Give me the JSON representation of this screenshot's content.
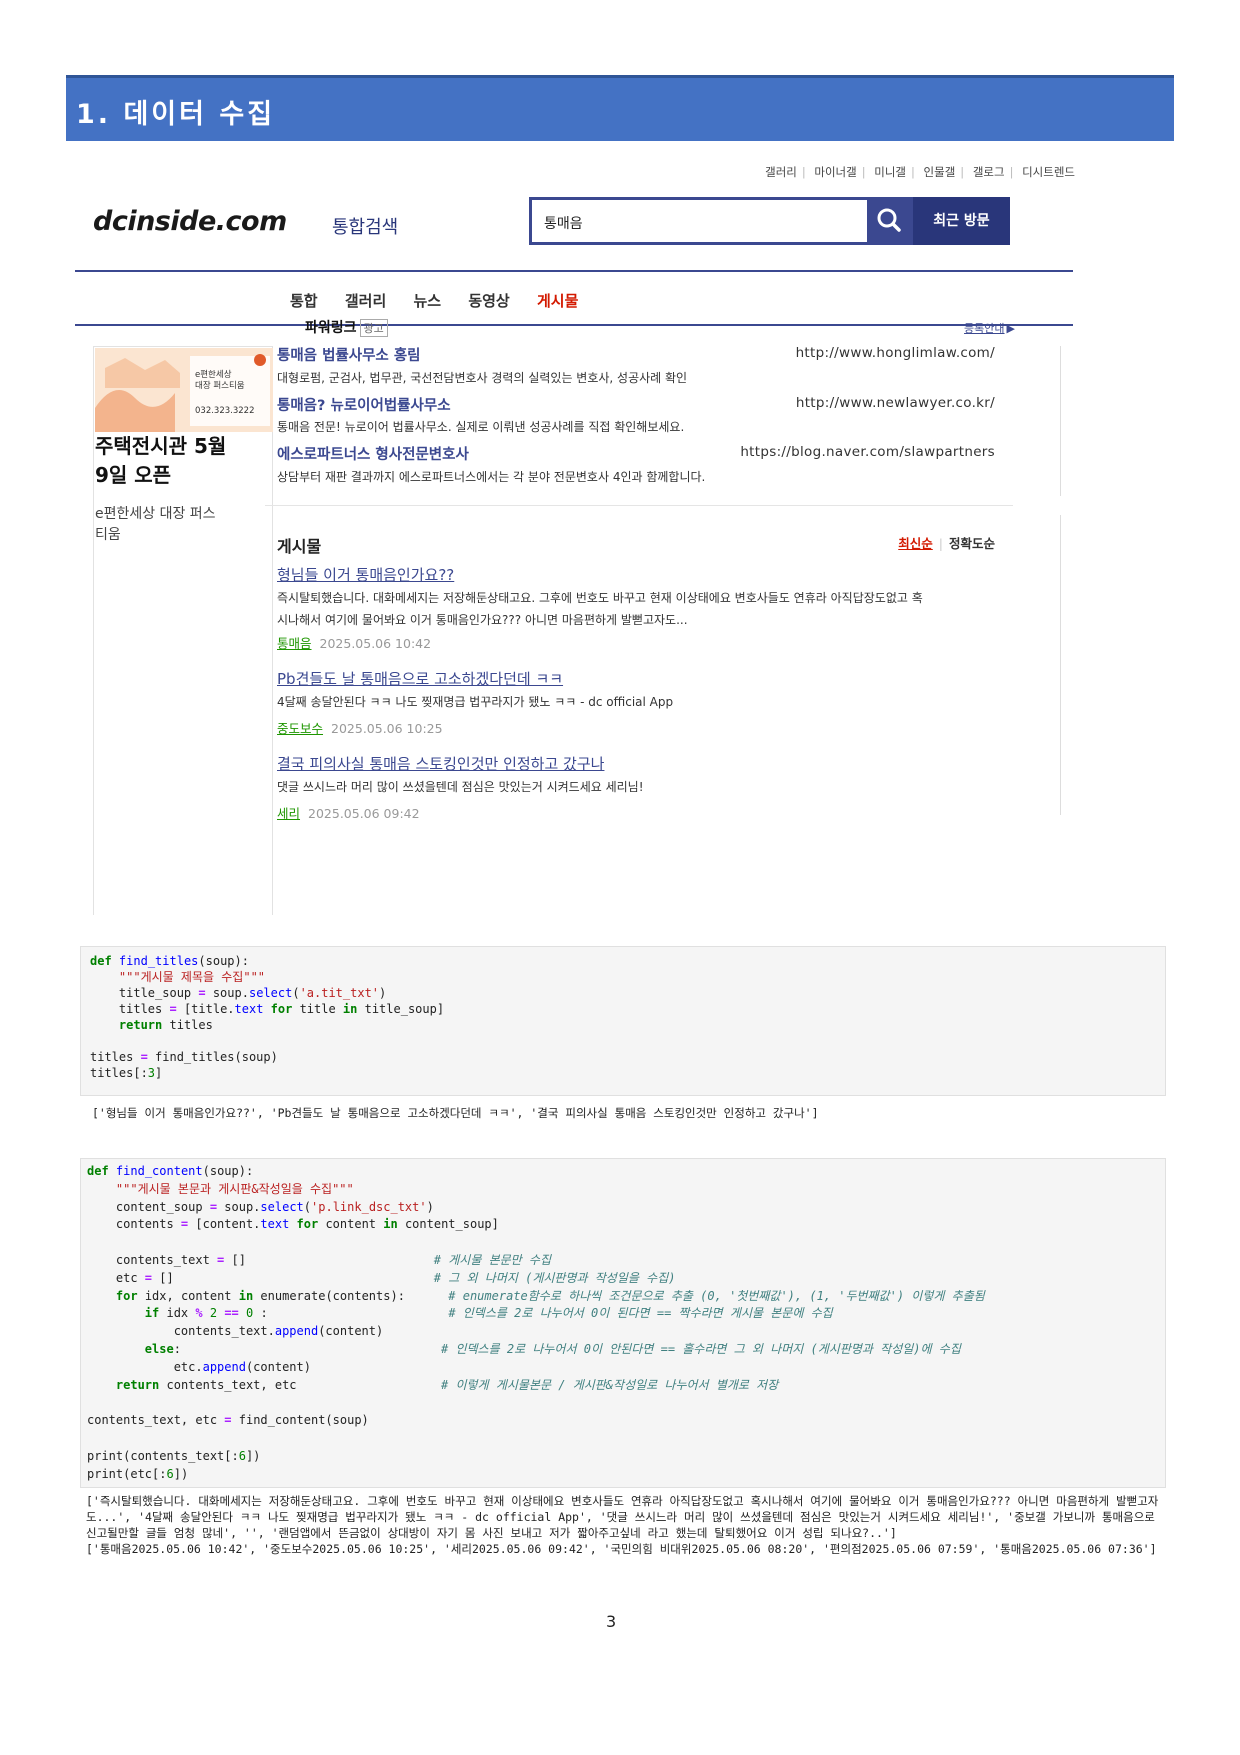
{
  "section": {
    "title": "1. 데이터 수집"
  },
  "screenshot": {
    "top_links": [
      "갤러리",
      "마이너갤",
      "미니갤",
      "인물갤",
      "갤로그",
      "디시트렌드"
    ],
    "logo": "dcinside.com",
    "logo_sub": "통합검색",
    "search_value": "통매음",
    "recent_button": "최근 방문",
    "tabs": [
      "통합",
      "갤러리",
      "뉴스",
      "동영상",
      "게시물"
    ],
    "side_ad": {
      "title_line1": "주택전시관 5월",
      "title_line2": "9일 오픈",
      "desc_line1": "e편한세상 대장 퍼스",
      "desc_line2": "티움",
      "img_text1": "e편한세상",
      "img_text2": "대장 퍼스티움",
      "img_phone": "032.323.3222"
    },
    "powerlink": {
      "title": "파워링크",
      "badge": "광고",
      "register": "등록안내",
      "items": [
        {
          "title": "통매음 법률사무소 홍림",
          "url": "http://www.honglimlaw.com/",
          "desc": "대형로펌, 군검사, 법무관, 국선전담변호사 경력의 실력있는 변호사, 성공사례 확인"
        },
        {
          "title": "통매음? 뉴로이어법률사무소",
          "url": "http://www.newlawyer.co.kr/",
          "desc": "통매음 전문! 뉴로이어 법률사무소. 실제로 이뤄낸 성공사례를 직접 확인해보세요."
        },
        {
          "title": "에스로파트너스 형사전문변호사",
          "url": "https://blog.naver.com/slawpartners",
          "desc": "상담부터 재판 결과까지 에스로파트너스에서는 각 분야 전문변호사 4인과 함께합니다."
        }
      ]
    },
    "posts": {
      "title": "게시물",
      "sort_latest": "최신순",
      "sort_accuracy": "정확도순",
      "items": [
        {
          "title": "형님들 이거 통매음인가요??",
          "body": "즉시탈퇴했습니다. 대화메세지는 저장해둔상태고요. 그후에 번호도 바꾸고 현재 이상태에요 변호사들도 연휴라 아직답장도없고 혹시나해서 여기에 물어봐요 이거 통매음인가요??? 아니면 마음편하게 발뻗고자도...",
          "gallery": "통매음",
          "date": "2025.05.06 10:42"
        },
        {
          "title": "Pb견들도 날 통매음으로 고소하겠다던데 ㅋㅋ",
          "body": "4달째 송달안된다 ㅋㅋ 나도 찢재명급 법꾸라지가 됐노 ㅋㅋ - dc official App",
          "gallery": "중도보수",
          "date": "2025.05.06 10:25"
        },
        {
          "title": "결국 피의사실 통매음 스토킹인것만 인정하고 갔구나",
          "body": "댓글 쓰시느라 머리 많이 쓰셨을텐데 점심은 맛있는거 시켜드세요 세리님!",
          "gallery": "세리",
          "date": "2025.05.06 09:42"
        }
      ]
    }
  },
  "cell1": {
    "output": "['형님들 이거 통매음인가요??', 'Pb견들도 날 통매음으로 고소하겠다던데 ㅋㅋ', '결국 피의사실 통매음 스토킹인것만 인정하고 갔구나']"
  },
  "cell2": {
    "output_line1": "['즉시탈퇴했습니다. 대화메세지는 저장해둔상태고요. 그후에 번호도 바꾸고 현재 이상태에요 변호사들도 연휴라 아직답장도없고 혹시나해서 여기에 물어봐요 이거 통매음인가요??? 아니면 마음편하게 발뻗고자도...', '4달째 송달안된다 ㅋㅋ 나도 찢재명급 법꾸라지가 됐노 ㅋㅋ - dc official App', '댓글 쓰시느라 머리 많이 쓰셨을텐데 점심은 맛있는거 시켜드세요 세리님!', '중보갤 가보니까 통매음으로 신고될만할 글들 엄청 많네', '', '랜덤앱에서 뜬금없이 상대방이 자기 몸 사진 보내고 저가 짧아주고싶네 라고 했는데 탈퇴했어요 이거 성립 되나요?..']",
    "output_line2": "['통매음2025.05.06 10:42', '중도보수2025.05.06 10:25', '세리2025.05.06 09:42', '국민의힘 비대위2025.05.06 08:20', '편의점2025.05.06 07:59', '통매음2025.05.06 07:36']"
  },
  "page_number": "3"
}
